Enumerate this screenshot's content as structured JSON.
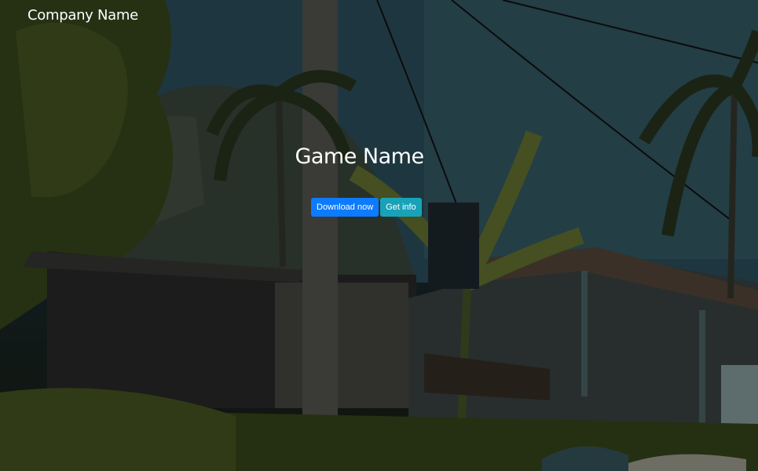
{
  "navbar": {
    "brand": "Company Name"
  },
  "hero": {
    "title": "Game Name",
    "primary_button": "Download now",
    "secondary_button": "Get info"
  },
  "colors": {
    "primary": "#0d7bfd",
    "info": "#18a2b8"
  }
}
